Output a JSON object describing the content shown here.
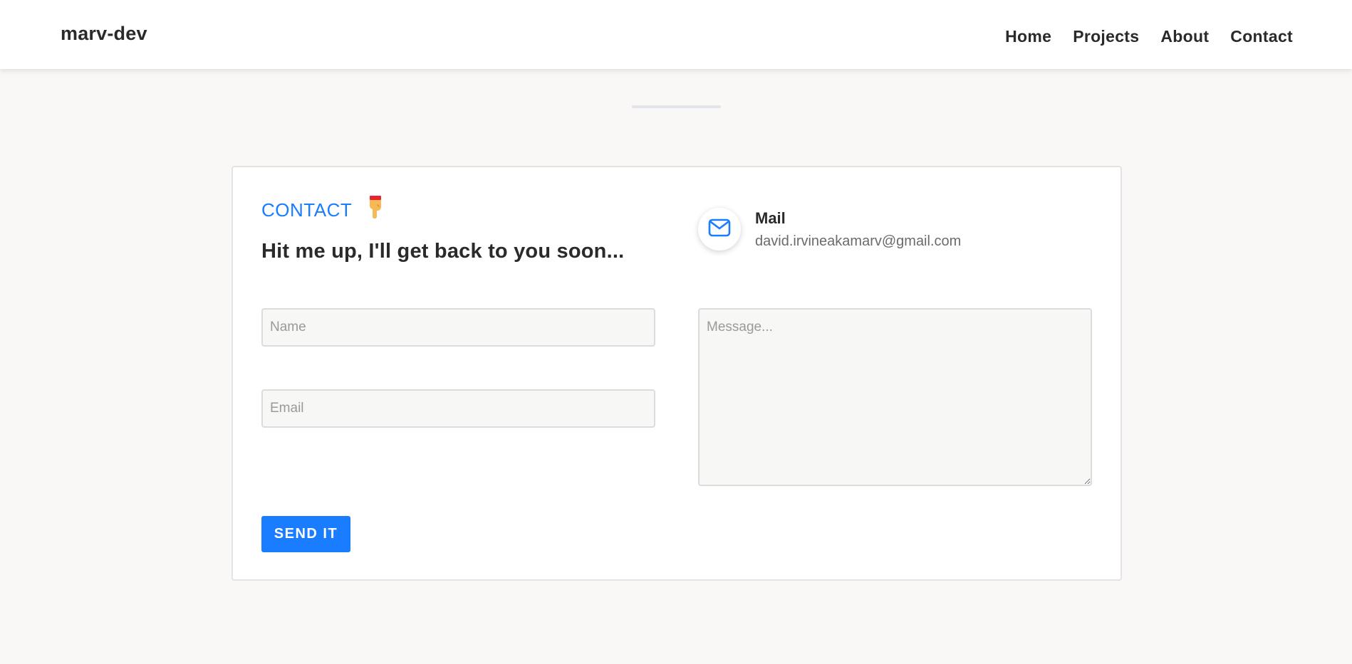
{
  "header": {
    "logo": "marv-dev",
    "nav": [
      {
        "label": "Home"
      },
      {
        "label": "Projects"
      },
      {
        "label": "About"
      },
      {
        "label": "Contact"
      }
    ]
  },
  "contact": {
    "kicker": "CONTACT",
    "kicker_icon": "pointing-down-hand-icon",
    "headline": "Hit me up, I'll get back to you soon...",
    "mail": {
      "icon": "envelope-icon",
      "title": "Mail",
      "address": "david.irvineakamarv@gmail.com"
    },
    "form": {
      "name_placeholder": "Name",
      "email_placeholder": "Email",
      "message_placeholder": "Message...",
      "send_label": "SEND IT"
    }
  },
  "colors": {
    "accent": "#1a7cff",
    "background": "#f9f8f6",
    "card": "#ffffff",
    "text": "#2a2a2a"
  }
}
